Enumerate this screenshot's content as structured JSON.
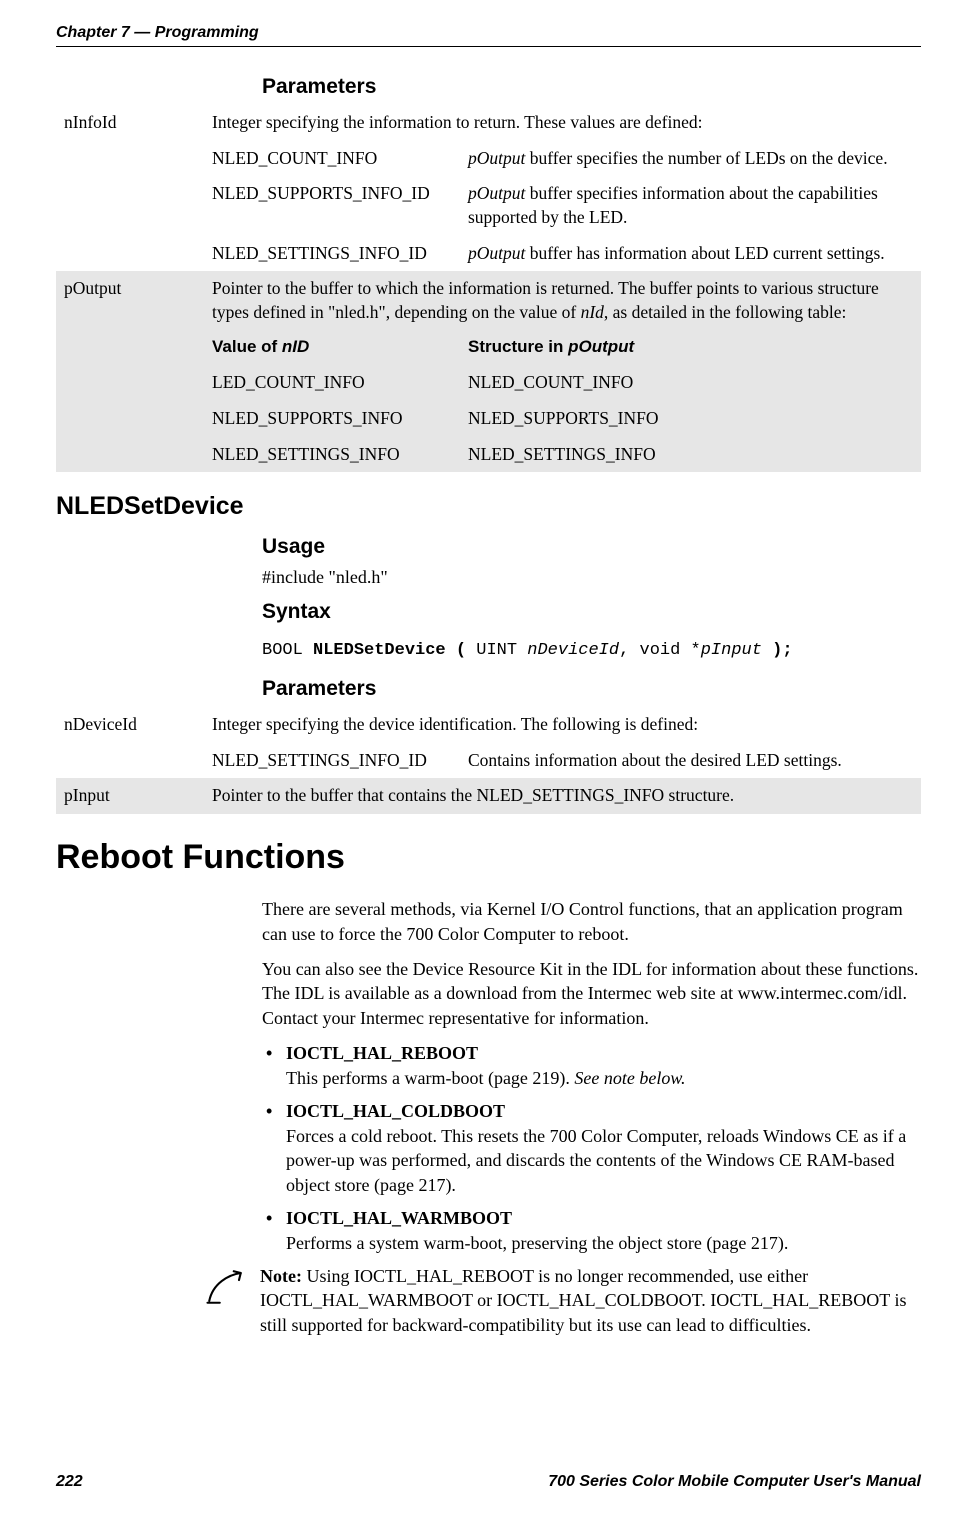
{
  "runhead": {
    "chapter": "Chapter 7",
    "sep": " —  ",
    "title": "Programming"
  },
  "sec1": {
    "params_heading": "Parameters",
    "row1": {
      "key": "nInfoId",
      "desc": "Integer specifying the information to return. These values are defined:",
      "a1": "NLED_COUNT_INFO",
      "b1a": "pOutput",
      "b1b": " buffer specifies the number of LEDs on the device.",
      "a2": "NLED_SUPPORTS_INFO_ID",
      "b2a": "pOutput",
      "b2b": " buffer specifies information about the capabilities supported by the LED.",
      "a3": "NLED_SETTINGS_INFO_ID",
      "b3a": "pOutput",
      "b3b": " buffer has information about LED current settings."
    },
    "row2": {
      "key": "pOutput",
      "desc_a": "Pointer to the buffer to which the information is returned. The buffer points to various structure types defined in \"nled.h\", depending on the value of ",
      "desc_i": "nId",
      "desc_b": ", as detailed in the following table:",
      "h_a_pre": "Value of ",
      "h_a_i": "nID",
      "h_b_pre": "Structure in ",
      "h_b_i": "pOutput",
      "a1": "LED_COUNT_INFO",
      "b1": "NLED_COUNT_INFO",
      "a2": "NLED_SUPPORTS_INFO",
      "b2": "NLED_SUPPORTS_INFO",
      "a3": "NLED_SETTINGS_INFO",
      "b3": "NLED_SETTINGS_INFO"
    }
  },
  "sec2": {
    "heading": "NLEDSetDevice",
    "usage_h": "Usage",
    "usage_body": "#include \"nled.h\"",
    "syntax_h": "Syntax",
    "syntax": {
      "p1": "BOOL ",
      "p2": "NLEDSetDevice ( ",
      "p3": "UINT ",
      "p4": "nDeviceId",
      "p5": ", void *",
      "p6": "pInput",
      "p7": " );"
    },
    "params_heading": "Parameters",
    "row1": {
      "key": "nDeviceId",
      "desc": "Integer specifying the device identification. The following is defined:",
      "a1": "NLED_SETTINGS_INFO_ID",
      "b1": "Contains information about the desired LED settings."
    },
    "row2": {
      "key": "pInput",
      "desc": "Pointer to the buffer that contains the NLED_SETTINGS_INFO structure."
    }
  },
  "sec3": {
    "heading": "Reboot Functions",
    "p1": "There are several methods, via Kernel I/O Control functions, that an application program can use to force the 700 Color Computer to reboot.",
    "p2": "You can also see the Device Resource Kit in the IDL for information about these functions. The IDL is available as a download from the Intermec web site at www.intermec.com/idl. Contact your Intermec representative for information.",
    "b1_t": "IOCTL_HAL_REBOOT",
    "b1_d_a": "This performs a warm-boot (page 219). ",
    "b1_d_i": "See note below.",
    "b2_t": "IOCTL_HAL_COLDBOOT",
    "b2_d": "Forces a cold reboot. This resets the 700 Color Computer, reloads Windows CE as if a power-up was performed, and discards the contents of the Windows CE RAM-based object store (page 217).",
    "b3_t": "IOCTL_HAL_WARMBOOT",
    "b3_d": "Performs a system warm-boot, preserving the object store (page 217).",
    "note_b": "Note:  ",
    "note": "Using IOCTL_HAL_REBOOT is no longer recommended, use either IOCTL_HAL_WARMBOOT or IOCTL_HAL_COLDBOOT. IOCTL_HAL_REBOOT is still supported for backward-compatibility but its use can lead to difficulties."
  },
  "footer": {
    "page": "222",
    "title": "700 Series Color Mobile Computer User's Manual"
  },
  "chart_data": {
    "type": "table",
    "tables": [
      {
        "title": "NLEDGetDeviceInfo Parameters",
        "rows": [
          {
            "param": "nInfoId",
            "description": "Integer specifying the information to return. These values are defined:",
            "defined_values": [
              {
                "name": "NLED_COUNT_INFO",
                "meaning": "pOutput buffer specifies the number of LEDs on the device."
              },
              {
                "name": "NLED_SUPPORTS_INFO_ID",
                "meaning": "pOutput buffer specifies information about the capabilities supported by the LED."
              },
              {
                "name": "NLED_SETTINGS_INFO_ID",
                "meaning": "pOutput buffer has information about LED current settings."
              }
            ]
          },
          {
            "param": "pOutput",
            "description": "Pointer to the buffer to which the information is returned. The buffer points to various structure types defined in \"nled.h\", depending on the value of nId, as detailed in the following table:",
            "mapping": [
              {
                "value_of_nID": "LED_COUNT_INFO",
                "structure_in_pOutput": "NLED_COUNT_INFO"
              },
              {
                "value_of_nID": "NLED_SUPPORTS_INFO",
                "structure_in_pOutput": "NLED_SUPPORTS_INFO"
              },
              {
                "value_of_nID": "NLED_SETTINGS_INFO",
                "structure_in_pOutput": "NLED_SETTINGS_INFO"
              }
            ]
          }
        ]
      },
      {
        "title": "NLEDSetDevice Parameters",
        "rows": [
          {
            "param": "nDeviceId",
            "description": "Integer specifying the device identification. The following is defined:",
            "defined_values": [
              {
                "name": "NLED_SETTINGS_INFO_ID",
                "meaning": "Contains information about the desired LED settings."
              }
            ]
          },
          {
            "param": "pInput",
            "description": "Pointer to the buffer that contains the NLED_SETTINGS_INFO structure."
          }
        ]
      }
    ]
  }
}
